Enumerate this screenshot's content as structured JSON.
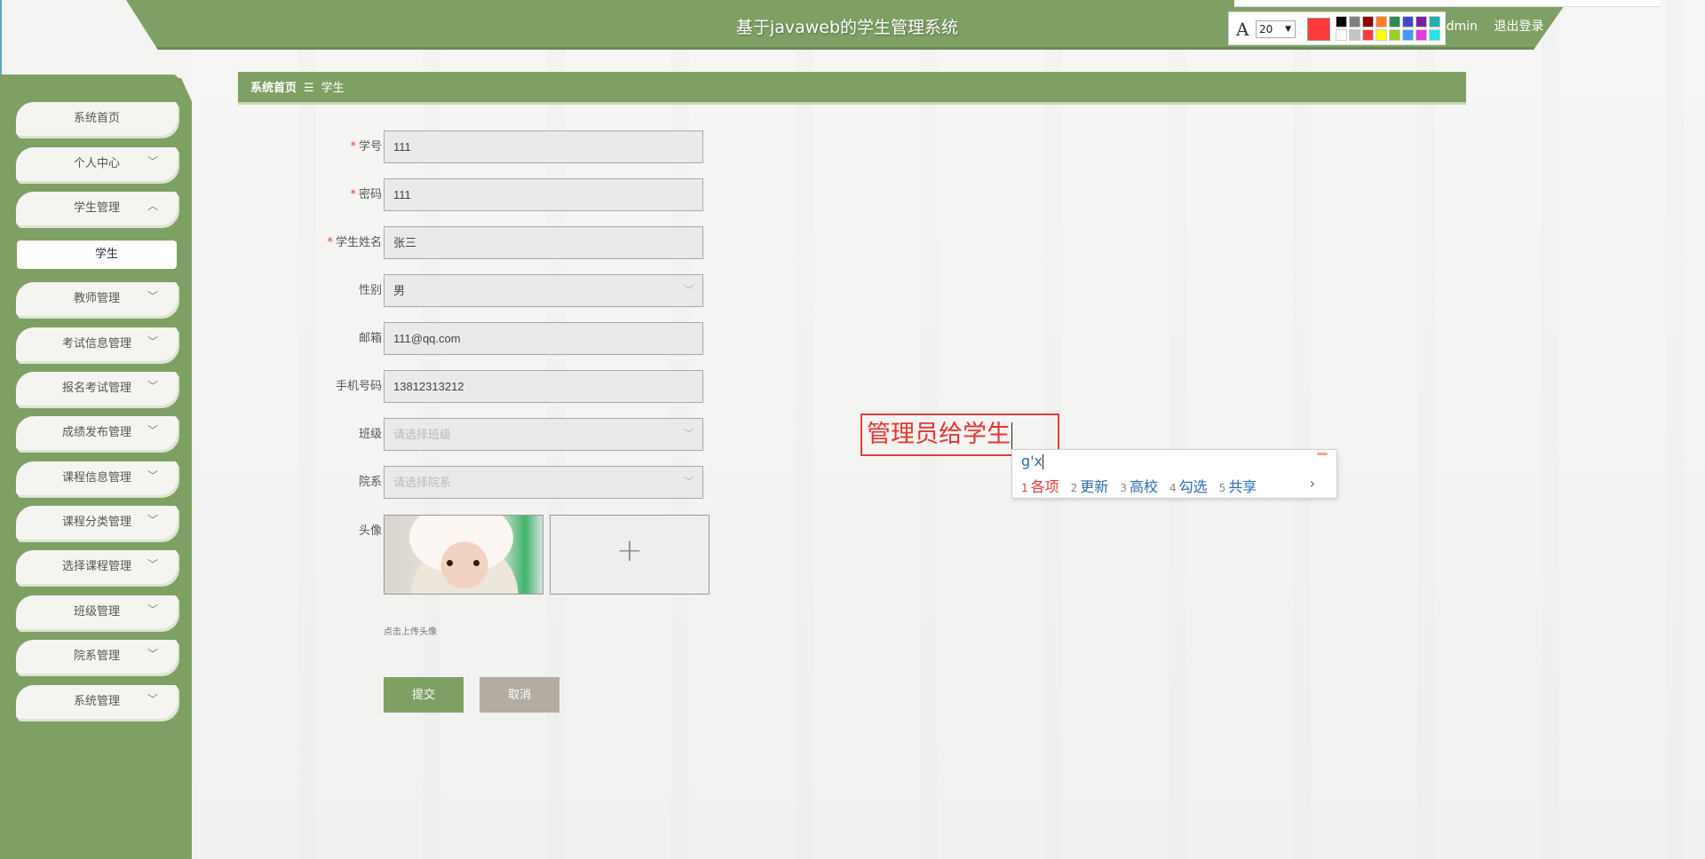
{
  "app": {
    "title": "基于javaweb的学生管理系统"
  },
  "user": {
    "name": "admin",
    "logout": "退出登录"
  },
  "draw_toolbar": {
    "font_icon": "A",
    "font_size": "20",
    "current_color": "#ff3b3b",
    "palette": [
      "#000000",
      "#7f7f7f",
      "#8b0000",
      "#ff7f27",
      "#2e8b57",
      "#3f48cc",
      "#7b1fa2",
      "#20b2aa",
      "#ffffff",
      "#c3c3c3",
      "#ff3b3b",
      "#ffff00",
      "#9ccc2a",
      "#3f9bff",
      "#e33ae3",
      "#27e3e3"
    ]
  },
  "sidebar": {
    "items": [
      {
        "label": "系统首页",
        "chevron": ""
      },
      {
        "label": "个人中心",
        "chevron": "﹀"
      },
      {
        "label": "学生管理",
        "chevron": "︿"
      },
      {
        "label": "学生",
        "chevron": "",
        "sub": true
      },
      {
        "label": "教师管理",
        "chevron": "﹀"
      },
      {
        "label": "考试信息管理",
        "chevron": "﹀"
      },
      {
        "label": "报名考试管理",
        "chevron": "﹀"
      },
      {
        "label": "成绩发布管理",
        "chevron": "﹀"
      },
      {
        "label": "课程信息管理",
        "chevron": "﹀"
      },
      {
        "label": "课程分类管理",
        "chevron": "﹀"
      },
      {
        "label": "选择课程管理",
        "chevron": "﹀"
      },
      {
        "label": "班级管理",
        "chevron": "﹀"
      },
      {
        "label": "院系管理",
        "chevron": "﹀"
      },
      {
        "label": "系统管理",
        "chevron": "﹀"
      }
    ]
  },
  "breadcrumb": {
    "home": "系统首页",
    "separator": "☰",
    "current": "学生"
  },
  "form": {
    "student_no": {
      "label": "学号",
      "value": "111"
    },
    "password": {
      "label": "密码",
      "value": "111"
    },
    "student_name": {
      "label": "学生姓名",
      "value": "张三"
    },
    "gender": {
      "label": "性别",
      "value": "男"
    },
    "email": {
      "label": "邮箱",
      "value": "111@qq.com"
    },
    "phone": {
      "label": "手机号码",
      "value": "13812313212"
    },
    "class": {
      "label": "班级",
      "placeholder": "请选择班级"
    },
    "department": {
      "label": "院系",
      "placeholder": "请选择院系"
    },
    "avatar": {
      "label": "头像",
      "upload_symbol": "+",
      "hint": "点击上传头像"
    },
    "submit": "提交",
    "cancel": "取消"
  },
  "annotation": {
    "text": "管理员给学生"
  },
  "ime": {
    "composition": "g'x",
    "candidates": [
      {
        "n": "1",
        "text": "各项"
      },
      {
        "n": "2",
        "text": "更新"
      },
      {
        "n": "3",
        "text": "高校"
      },
      {
        "n": "4",
        "text": "勾选"
      },
      {
        "n": "5",
        "text": "共享"
      }
    ],
    "next": "›"
  }
}
